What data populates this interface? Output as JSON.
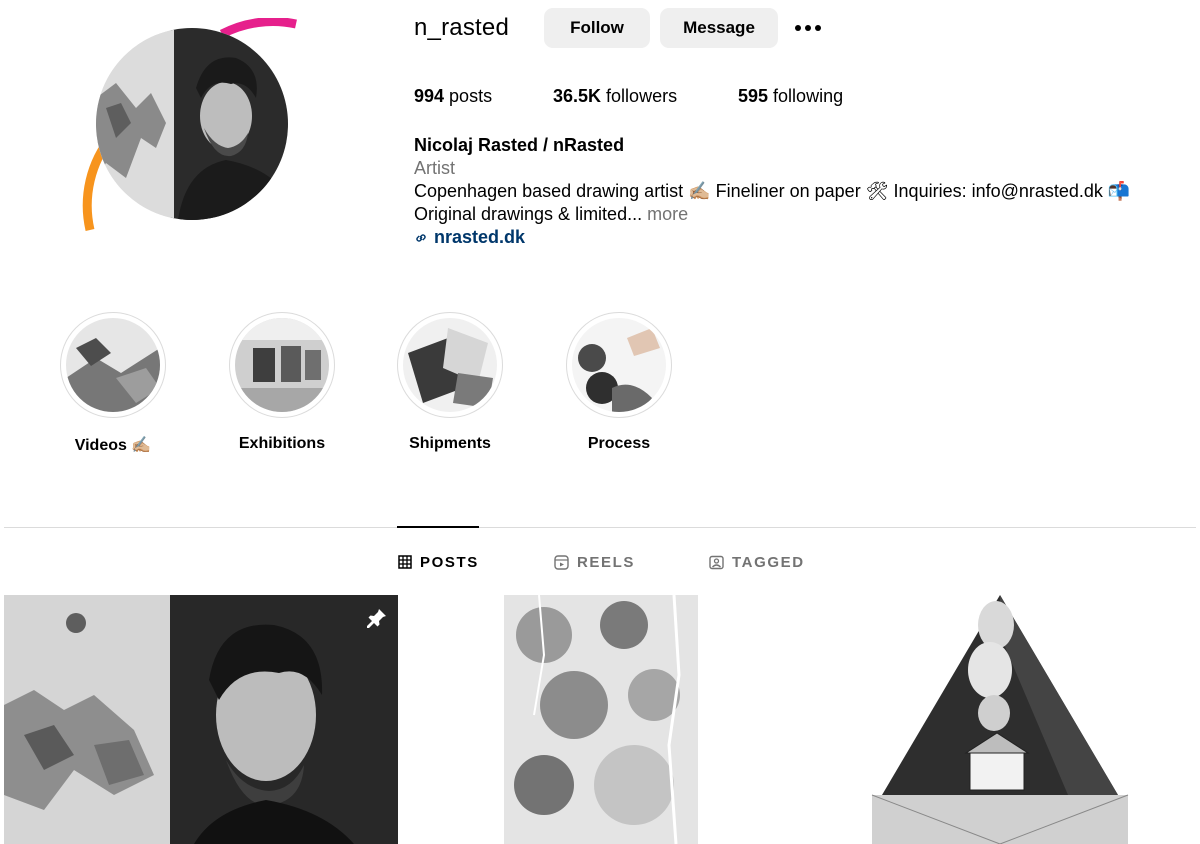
{
  "profile": {
    "username": "n_rasted",
    "follow_label": "Follow",
    "message_label": "Message",
    "more_icon": "more-horizontal-icon",
    "ring_colors": {
      "top": "#e6208c",
      "bottom": "#f7941d"
    }
  },
  "stats": {
    "posts_count": "994",
    "posts_label": " posts",
    "followers_count": "36.5K",
    "followers_label": " followers",
    "following_count": "595",
    "following_label": " following"
  },
  "bio": {
    "full_name": "Nicolaj Rasted / nRasted",
    "category": "Artist",
    "line1": "Copenhagen based drawing artist ✍🏼 Fineliner on paper 🛠 Inquiries: info@nrasted.dk 📬",
    "line2": "Original drawings & limited...",
    "more_label": " more",
    "link_icon": "link-icon",
    "link_text": "nrasted.dk",
    "link_color": "#00376b"
  },
  "highlights": [
    {
      "label": "Videos ✍🏼"
    },
    {
      "label": "Exhibitions"
    },
    {
      "label": "Shipments"
    },
    {
      "label": "Process"
    }
  ],
  "tabs": [
    {
      "label": "POSTS",
      "icon": "grid-icon",
      "active": true
    },
    {
      "label": "REELS",
      "icon": "reels-icon",
      "active": false
    },
    {
      "label": "TAGGED",
      "icon": "tagged-icon",
      "active": false
    }
  ],
  "posts": [
    {
      "pinned": true,
      "pin_icon": "pin-icon"
    },
    {
      "pinned": false
    },
    {
      "pinned": false
    }
  ]
}
